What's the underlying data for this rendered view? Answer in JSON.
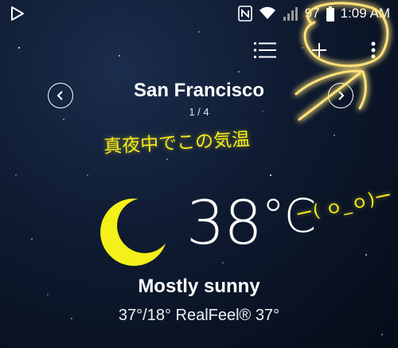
{
  "status_bar": {
    "battery_percent": "97",
    "time": "1:09 AM",
    "icons": [
      "play-store-icon",
      "nfc-icon",
      "wifi-icon",
      "signal-icon",
      "battery-icon"
    ]
  },
  "toolbar": {
    "icons": [
      "list-icon",
      "add-location-icon",
      "more-vert-icon"
    ]
  },
  "location": {
    "city": "San Francisco",
    "page_indicator": "1 / 4"
  },
  "weather": {
    "temperature": "38",
    "unit": "°C",
    "condition": "Mostly sunny",
    "detail": "37°/18° RealFeel® 37°",
    "icon": "moon-icon"
  },
  "annotation": {
    "text": "真夜中でこの気温",
    "face": "ー( ｏ_ｏ)ー",
    "color": "#f2ea17"
  }
}
